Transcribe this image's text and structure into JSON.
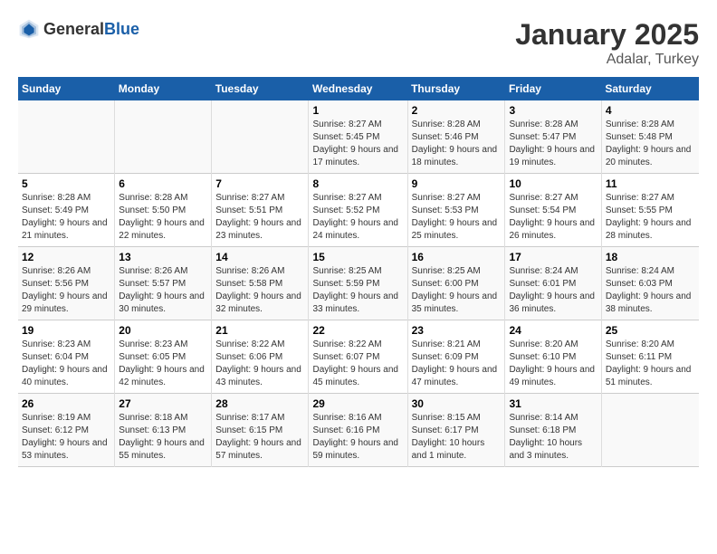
{
  "header": {
    "logo_general": "General",
    "logo_blue": "Blue",
    "month": "January 2025",
    "location": "Adalar, Turkey"
  },
  "days_of_week": [
    "Sunday",
    "Monday",
    "Tuesday",
    "Wednesday",
    "Thursday",
    "Friday",
    "Saturday"
  ],
  "weeks": [
    [
      {
        "day": "",
        "info": ""
      },
      {
        "day": "",
        "info": ""
      },
      {
        "day": "",
        "info": ""
      },
      {
        "day": "1",
        "info": "Sunrise: 8:27 AM\nSunset: 5:45 PM\nDaylight: 9 hours and 17 minutes."
      },
      {
        "day": "2",
        "info": "Sunrise: 8:28 AM\nSunset: 5:46 PM\nDaylight: 9 hours and 18 minutes."
      },
      {
        "day": "3",
        "info": "Sunrise: 8:28 AM\nSunset: 5:47 PM\nDaylight: 9 hours and 19 minutes."
      },
      {
        "day": "4",
        "info": "Sunrise: 8:28 AM\nSunset: 5:48 PM\nDaylight: 9 hours and 20 minutes."
      }
    ],
    [
      {
        "day": "5",
        "info": "Sunrise: 8:28 AM\nSunset: 5:49 PM\nDaylight: 9 hours and 21 minutes."
      },
      {
        "day": "6",
        "info": "Sunrise: 8:28 AM\nSunset: 5:50 PM\nDaylight: 9 hours and 22 minutes."
      },
      {
        "day": "7",
        "info": "Sunrise: 8:27 AM\nSunset: 5:51 PM\nDaylight: 9 hours and 23 minutes."
      },
      {
        "day": "8",
        "info": "Sunrise: 8:27 AM\nSunset: 5:52 PM\nDaylight: 9 hours and 24 minutes."
      },
      {
        "day": "9",
        "info": "Sunrise: 8:27 AM\nSunset: 5:53 PM\nDaylight: 9 hours and 25 minutes."
      },
      {
        "day": "10",
        "info": "Sunrise: 8:27 AM\nSunset: 5:54 PM\nDaylight: 9 hours and 26 minutes."
      },
      {
        "day": "11",
        "info": "Sunrise: 8:27 AM\nSunset: 5:55 PM\nDaylight: 9 hours and 28 minutes."
      }
    ],
    [
      {
        "day": "12",
        "info": "Sunrise: 8:26 AM\nSunset: 5:56 PM\nDaylight: 9 hours and 29 minutes."
      },
      {
        "day": "13",
        "info": "Sunrise: 8:26 AM\nSunset: 5:57 PM\nDaylight: 9 hours and 30 minutes."
      },
      {
        "day": "14",
        "info": "Sunrise: 8:26 AM\nSunset: 5:58 PM\nDaylight: 9 hours and 32 minutes."
      },
      {
        "day": "15",
        "info": "Sunrise: 8:25 AM\nSunset: 5:59 PM\nDaylight: 9 hours and 33 minutes."
      },
      {
        "day": "16",
        "info": "Sunrise: 8:25 AM\nSunset: 6:00 PM\nDaylight: 9 hours and 35 minutes."
      },
      {
        "day": "17",
        "info": "Sunrise: 8:24 AM\nSunset: 6:01 PM\nDaylight: 9 hours and 36 minutes."
      },
      {
        "day": "18",
        "info": "Sunrise: 8:24 AM\nSunset: 6:03 PM\nDaylight: 9 hours and 38 minutes."
      }
    ],
    [
      {
        "day": "19",
        "info": "Sunrise: 8:23 AM\nSunset: 6:04 PM\nDaylight: 9 hours and 40 minutes."
      },
      {
        "day": "20",
        "info": "Sunrise: 8:23 AM\nSunset: 6:05 PM\nDaylight: 9 hours and 42 minutes."
      },
      {
        "day": "21",
        "info": "Sunrise: 8:22 AM\nSunset: 6:06 PM\nDaylight: 9 hours and 43 minutes."
      },
      {
        "day": "22",
        "info": "Sunrise: 8:22 AM\nSunset: 6:07 PM\nDaylight: 9 hours and 45 minutes."
      },
      {
        "day": "23",
        "info": "Sunrise: 8:21 AM\nSunset: 6:09 PM\nDaylight: 9 hours and 47 minutes."
      },
      {
        "day": "24",
        "info": "Sunrise: 8:20 AM\nSunset: 6:10 PM\nDaylight: 9 hours and 49 minutes."
      },
      {
        "day": "25",
        "info": "Sunrise: 8:20 AM\nSunset: 6:11 PM\nDaylight: 9 hours and 51 minutes."
      }
    ],
    [
      {
        "day": "26",
        "info": "Sunrise: 8:19 AM\nSunset: 6:12 PM\nDaylight: 9 hours and 53 minutes."
      },
      {
        "day": "27",
        "info": "Sunrise: 8:18 AM\nSunset: 6:13 PM\nDaylight: 9 hours and 55 minutes."
      },
      {
        "day": "28",
        "info": "Sunrise: 8:17 AM\nSunset: 6:15 PM\nDaylight: 9 hours and 57 minutes."
      },
      {
        "day": "29",
        "info": "Sunrise: 8:16 AM\nSunset: 6:16 PM\nDaylight: 9 hours and 59 minutes."
      },
      {
        "day": "30",
        "info": "Sunrise: 8:15 AM\nSunset: 6:17 PM\nDaylight: 10 hours and 1 minute."
      },
      {
        "day": "31",
        "info": "Sunrise: 8:14 AM\nSunset: 6:18 PM\nDaylight: 10 hours and 3 minutes."
      },
      {
        "day": "",
        "info": ""
      }
    ]
  ]
}
